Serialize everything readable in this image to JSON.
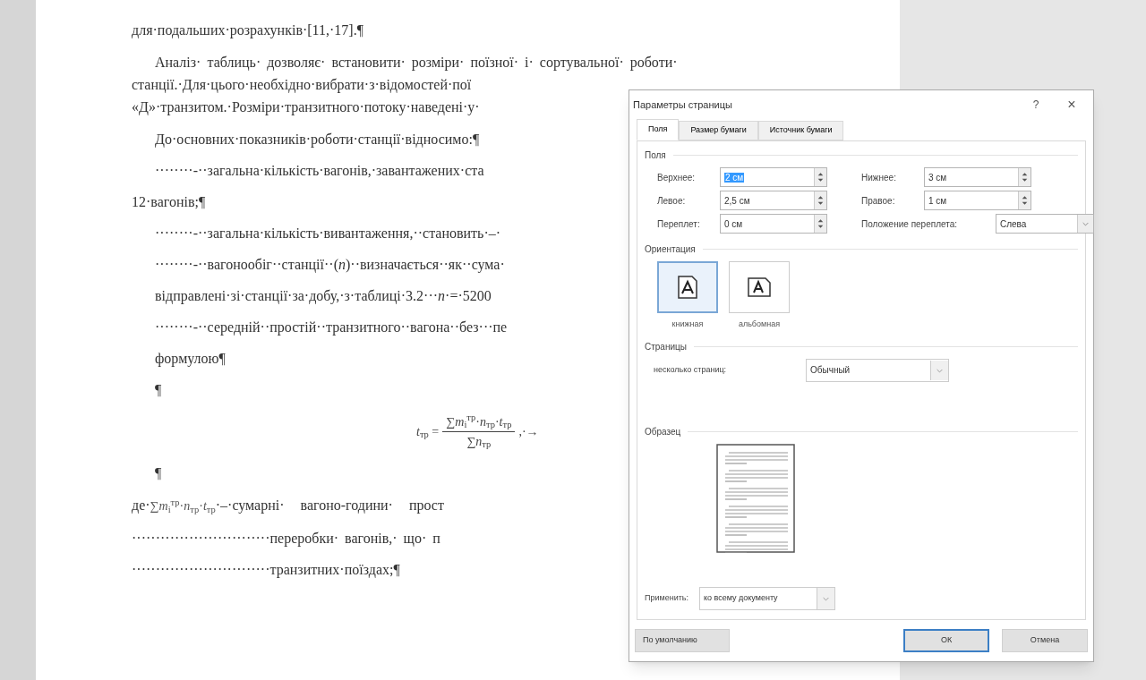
{
  "document": {
    "paragraphs": [
      {
        "kind": "plain",
        "lines": [
          "для·подальших·розрахунків·[11,·17].¶"
        ]
      },
      {
        "kind": "indent",
        "lines": [
          "Аналіз· таблиць· дозволяє· встановити· розміри· поїзної· і· сортувальної· роботи·",
          "станції.·Для·цього·необхідно·вибрати·з·відомостей·пої",
          "«Д»·транзитом.·Розміри·транзитного·потоку·наведені·у·"
        ]
      },
      {
        "kind": "indent",
        "lines": [
          "До·основних·показників·роботи·станції·відносимо:¶"
        ]
      },
      {
        "kind": "indent",
        "lines": [
          "········-··загальна·кількість·вагонів,·завантажених·ста"
        ]
      },
      {
        "kind": "plain",
        "lines": [
          "12·вагонів;¶"
        ]
      },
      {
        "kind": "indent",
        "lines": [
          "········-··загальна·кількість·вивантаження,··становить·–·"
        ]
      },
      {
        "kind": "indent",
        "lines": [
          "········-··вагонообіг··станції··(*n*)··визначається··як··сума·"
        ]
      },
      {
        "kind": "indent",
        "lines": [
          "відправлені·зі·станції·за·добу,·з·таблиці·3.2···*n*·=·5200"
        ]
      },
      {
        "kind": "indent",
        "lines": [
          "········-··середній··простій··транзитного··вагона··без···пе"
        ]
      },
      {
        "kind": "indent",
        "lines": [
          "формулою¶"
        ]
      },
      {
        "kind": "indent",
        "lines": [
          "¶"
        ]
      },
      {
        "kind": "formula",
        "lhs": "*t*$_{тр}$ =",
        "numerator": "∑*m*$_{i}$$^{тр}$·*n*$_{тр}$·*t*$_{тр}$",
        "denominator": "∑*n*$_{тр}$",
        "tail": ",·→"
      },
      {
        "kind": "indent",
        "lines": [
          "¶"
        ]
      },
      {
        "kind": "where",
        "lead": "де·",
        "expression": "∑*m*$_{i}$$^{тр}$·*n*$_{тр}$·*t*$_{тр}$",
        "rest": "·–·сумарні· вагоно-години· прост"
      },
      {
        "kind": "plain",
        "lines": [
          "·····························переробки· вагонів,· що· п"
        ]
      },
      {
        "kind": "plain",
        "lines": [
          "·····························транзитних·поїздах;¶"
        ]
      }
    ]
  },
  "dialog": {
    "title": "Параметры страницы",
    "help": "?",
    "close": "×",
    "tabs": [
      {
        "label": "Поля",
        "selected": true
      },
      {
        "label": "Размер бумаги",
        "selected": false
      },
      {
        "label": "Источник бумаги",
        "selected": false
      }
    ],
    "margins": {
      "heading": "Поля",
      "fields": [
        {
          "kind": "spin",
          "label": "Верхнее:",
          "value": "2 см",
          "selected": true
        },
        {
          "kind": "spin",
          "label": "Нижнее:",
          "value": "3 см",
          "selected": false
        },
        {
          "kind": "spin",
          "label": "Левое:",
          "value": "2,5 см",
          "selected": false
        },
        {
          "kind": "spin",
          "label": "Правое:",
          "value": "1 см",
          "selected": false
        },
        {
          "kind": "spin",
          "label": "Переплет:",
          "value": "0 см",
          "selected": false
        },
        {
          "kind": "select",
          "label": "Положение переплета:",
          "value": "Слева",
          "selected": false
        }
      ]
    },
    "orientation": {
      "heading": "Ориентация",
      "options": [
        {
          "label": "книжная",
          "selected": true
        },
        {
          "label": "альбомная",
          "selected": false
        }
      ]
    },
    "pages": {
      "heading": "Страницы",
      "label": "несколько страниц:",
      "value": "Обычный"
    },
    "sample": {
      "heading": "Образец"
    },
    "apply": {
      "label": "Применить:",
      "value": "ко всему документу"
    },
    "buttons": [
      {
        "kind": "left",
        "label": "По умолчанию",
        "selected": false
      },
      {
        "kind": "right",
        "label": "ОК",
        "selected": true
      },
      {
        "kind": "right",
        "label": "Отмена",
        "selected": false
      }
    ]
  }
}
